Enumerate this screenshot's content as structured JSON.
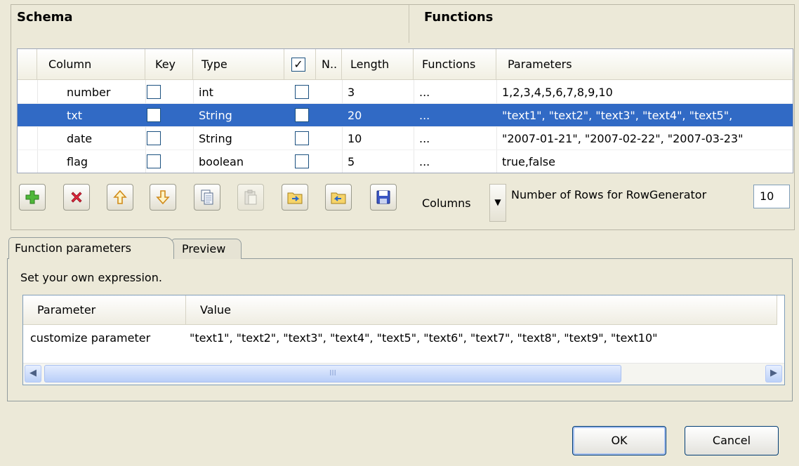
{
  "schema": {
    "title": "Schema",
    "functions_title": "Functions",
    "headers": {
      "column": "Column",
      "key": "Key",
      "type": "Type",
      "nullable": "N..",
      "length": "Length",
      "functions": "Functions",
      "parameters": "Parameters"
    },
    "rows": [
      {
        "column": "number",
        "type": "int",
        "length": "3",
        "functions": "...",
        "parameters": "1,2,3,4,5,6,7,8,9,10",
        "selected": false
      },
      {
        "column": "txt",
        "type": "String",
        "length": "20",
        "functions": "...",
        "parameters": "\"text1\", \"text2\", \"text3\", \"text4\", \"text5\",",
        "selected": true
      },
      {
        "column": "date",
        "type": "String",
        "length": "10",
        "functions": "...",
        "parameters": "\"2007-01-21\", \"2007-02-22\", \"2007-03-23\"",
        "selected": false
      },
      {
        "column": "flag",
        "type": "boolean",
        "length": "5",
        "functions": "...",
        "parameters": "true,false",
        "selected": false
      }
    ]
  },
  "toolbar": {
    "buttons": [
      "add-icon",
      "delete-icon",
      "move-up-icon",
      "move-down-icon",
      "copy-icon",
      "paste-icon",
      "import-icon",
      "export-icon",
      "save-icon"
    ],
    "columns_label": "Columns",
    "rows_label": "Number of Rows for RowGenerator",
    "rows_value": "10"
  },
  "tabs": {
    "function_parameters": "Function parameters",
    "preview": "Preview"
  },
  "params": {
    "description": "Set your own expression.",
    "headers": {
      "parameter": "Parameter",
      "value": "Value"
    },
    "rows": [
      {
        "parameter": "customize parameter",
        "value": "\"text1\", \"text2\", \"text3\", \"text4\", \"text5\", \"text6\", \"text7\", \"text8\", \"text9\", \"text10\""
      }
    ],
    "scroll_thumb": "III"
  },
  "buttons": {
    "ok": "OK",
    "cancel": "Cancel"
  },
  "colors": {
    "selection": "#316ac5",
    "background": "#ece9d8"
  }
}
